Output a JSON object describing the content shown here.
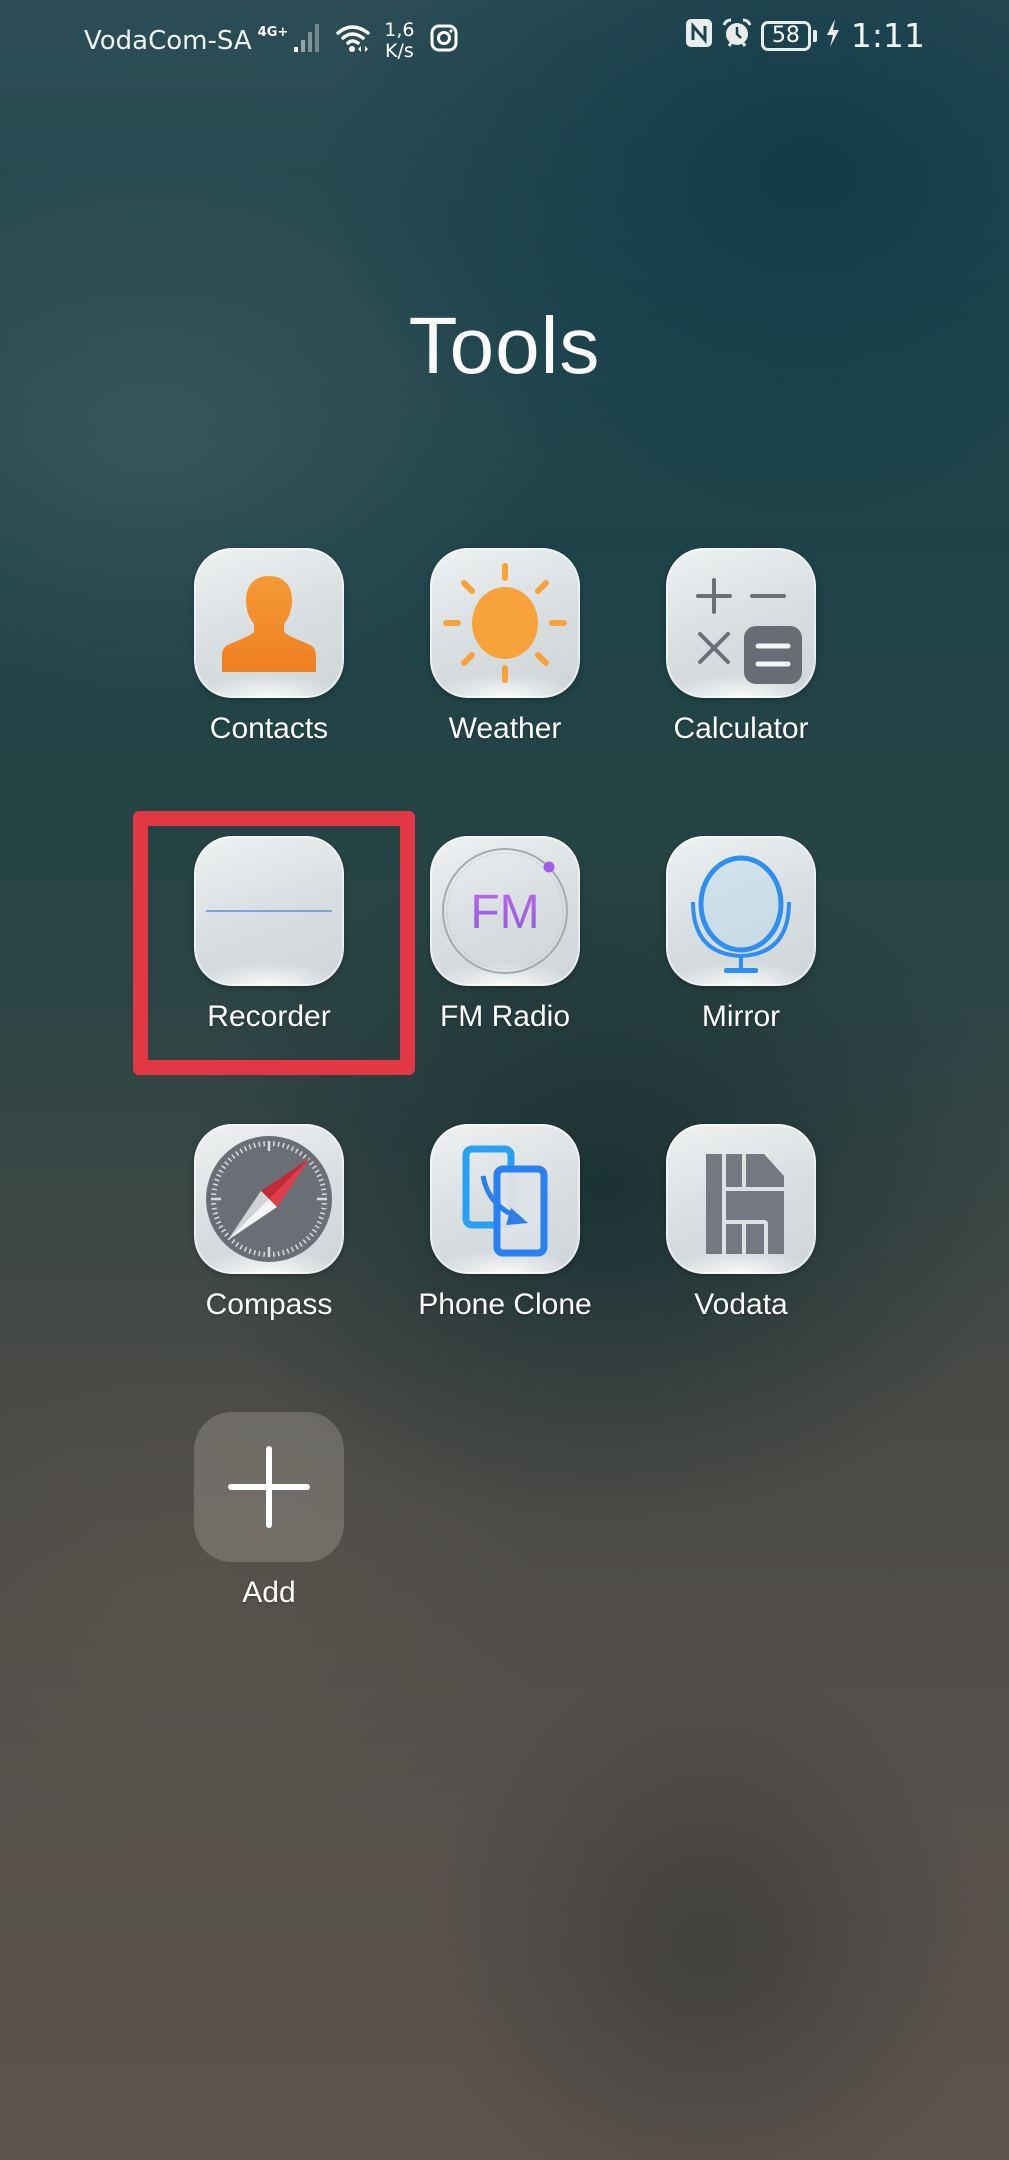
{
  "status_bar": {
    "carrier": "VodaCom-SA",
    "network_type": "4G+",
    "net_speed_value": "1,6",
    "net_speed_unit": "K/s",
    "battery_level": "58",
    "time": "1:11",
    "icons": [
      "signal-icon",
      "wifi-icon",
      "instagram-icon",
      "nfc-icon",
      "alarm-icon",
      "battery-icon",
      "charging-icon"
    ]
  },
  "folder": {
    "title": "Tools",
    "apps": [
      {
        "label": "Contacts",
        "icon": "contacts-icon",
        "highlighted": false
      },
      {
        "label": "Weather",
        "icon": "weather-icon",
        "highlighted": false
      },
      {
        "label": "Calculator",
        "icon": "calculator-icon",
        "highlighted": false
      },
      {
        "label": "Recorder",
        "icon": "recorder-icon",
        "highlighted": true
      },
      {
        "label": "FM Radio",
        "icon": "fm-radio-icon",
        "highlighted": false
      },
      {
        "label": "Mirror",
        "icon": "mirror-icon",
        "highlighted": false
      },
      {
        "label": "Compass",
        "icon": "compass-icon",
        "highlighted": false
      },
      {
        "label": "Phone Clone",
        "icon": "phone-clone-icon",
        "highlighted": false
      },
      {
        "label": "Vodata",
        "icon": "vodata-icon",
        "highlighted": false
      },
      {
        "label": "Add",
        "icon": "add-icon",
        "highlighted": false
      }
    ],
    "fm_icon_text": "FM"
  },
  "colors": {
    "highlight": "#e13843",
    "contacts_orange": "#f08a2a",
    "weather_orange": "#f7a23a",
    "recorder_blue": "#4a8fe8",
    "recorder_purple": "#8a66e0",
    "fm_purple": "#a35ee6",
    "mirror_blue": "#2f8ff0",
    "compass_gray": "#6a6f76",
    "compass_red": "#e33b4a",
    "phone_clone_blue": "#2a8ff2",
    "vodata_gray": "#737881"
  }
}
